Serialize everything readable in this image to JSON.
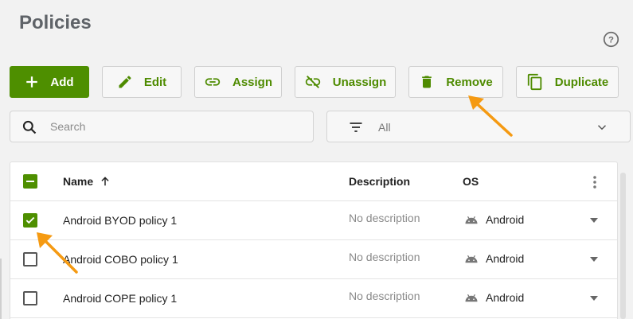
{
  "page": {
    "title": "Policies"
  },
  "toolbar": {
    "buttons": [
      {
        "id": "add",
        "label": "Add",
        "icon": "plus-icon"
      },
      {
        "id": "edit",
        "label": "Edit",
        "icon": "pencil-icon"
      },
      {
        "id": "assign",
        "label": "Assign",
        "icon": "link-icon"
      },
      {
        "id": "unassign",
        "label": "Unassign",
        "icon": "link-off-icon"
      },
      {
        "id": "remove",
        "label": "Remove",
        "icon": "trash-icon"
      },
      {
        "id": "duplicate",
        "label": "Duplicate",
        "icon": "copy-icon"
      }
    ]
  },
  "search": {
    "placeholder": "Search",
    "value": ""
  },
  "filter": {
    "value": "All",
    "icon": "filter-icon"
  },
  "table": {
    "columns": {
      "name": "Name",
      "description": "Description",
      "os": "OS"
    },
    "sort": "ascending",
    "rows": [
      {
        "name": "Android BYOD policy 1",
        "description": "No description",
        "os": "Android",
        "checked": true
      },
      {
        "name": "Android COBO policy 1",
        "description": "No description",
        "os": "Android",
        "checked": false
      },
      {
        "name": "Android COPE policy 1",
        "description": "No description",
        "os": "Android",
        "checked": false
      }
    ]
  },
  "colors": {
    "accent": "#4e8f00",
    "accent_text": "#4e8b00",
    "annotation_arrow": "#f59a12"
  }
}
